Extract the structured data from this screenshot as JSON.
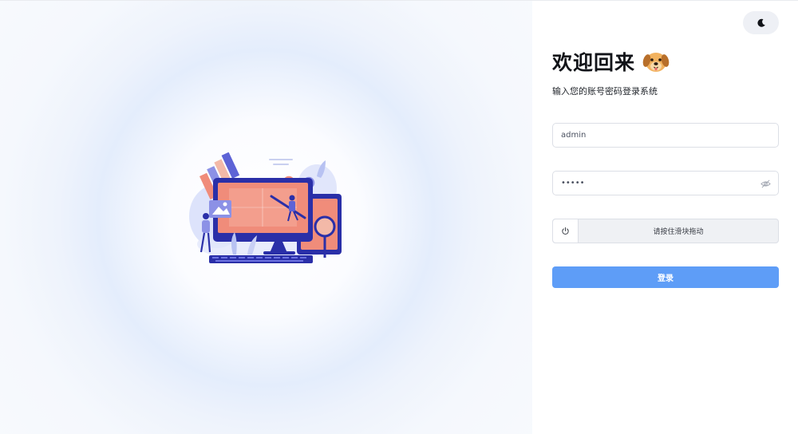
{
  "login": {
    "title": "欢迎回来",
    "subtitle": "输入您的账号密码登录系统",
    "username_value": "admin",
    "password_value": "12345",
    "slider_text": "请按住滑块拖动",
    "submit_label": "登录"
  },
  "icons": {
    "theme_toggle": "moon-icon",
    "password_visibility": "eye-icon",
    "slider_handle": "power-icon",
    "mascot": "dog-emoji-icon"
  },
  "colors": {
    "primary": "#5e9df7",
    "page_background": "#f8fafd",
    "field_border": "#dcdfe6"
  }
}
